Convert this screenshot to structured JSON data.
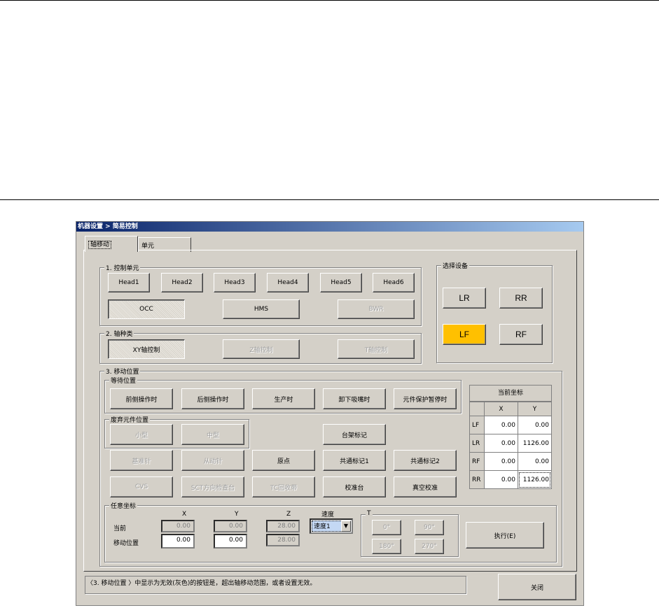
{
  "window": {
    "title": "机器设置 > 简易控制"
  },
  "tabs": [
    {
      "label": "轴移动"
    },
    {
      "label": "单元"
    }
  ],
  "control_unit": {
    "label": "1. 控制单元",
    "heads": [
      "Head1",
      "Head2",
      "Head3",
      "Head4",
      "Head5",
      "Head6"
    ],
    "occ": "OCC",
    "hms": "HMS",
    "bwr": "BWR"
  },
  "axis_type": {
    "label": "2. 轴种类",
    "xy": "XY轴控制",
    "z": "Z轴控制",
    "t": "T轴控制"
  },
  "device": {
    "label": "选择设备",
    "lr": "LR",
    "rr": "RR",
    "lf": "LF",
    "rf": "RF",
    "selected_color": "#ffc000"
  },
  "move_position": {
    "label": "3. 移动位置",
    "wait": {
      "label": "等待位置",
      "front": "前侧操作时",
      "rear": "后侧操作时",
      "production": "生产时",
      "nozzle": "卸下吸嘴时",
      "pause": "元件保护暂停时"
    },
    "discard": {
      "label": "废弃元件位置",
      "small": "小型",
      "medium": "中型"
    },
    "rack": "台架标记",
    "ref_pin": "基准针",
    "slave_pin": "从动针",
    "origin": "原点",
    "common1": "共通标记1",
    "common2": "共通标记2",
    "cvs": "CVS",
    "sct": "SCT方向检查台",
    "tc": "TC回收带",
    "calib": "校准台",
    "vacuum": "真空校准"
  },
  "current_coords": {
    "title": "当前坐标",
    "col_x": "X",
    "col_y": "Y",
    "rows": [
      {
        "label": "LF",
        "x": "0.00",
        "y": "0.00"
      },
      {
        "label": "LR",
        "x": "0.00",
        "y": "1126.00"
      },
      {
        "label": "RF",
        "x": "0.00",
        "y": "0.00"
      },
      {
        "label": "RR",
        "x": "0.00",
        "y": "1126.00"
      }
    ]
  },
  "arbitrary": {
    "label": "任意坐标",
    "col_x": "X",
    "col_y": "Y",
    "col_z": "Z",
    "speed_label": "速度",
    "current_label": "当前",
    "move_label": "移动位置",
    "current_x": "0.00",
    "current_y": "0.00",
    "current_z": "28.00",
    "move_x": "0.00",
    "move_y": "0.00",
    "move_z": "28.00",
    "speed_value": "速度1",
    "t_label": "T",
    "t0": "0°",
    "t90": "90°",
    "t180": "180°",
    "t270": "270°",
    "execute": "执行(E)"
  },
  "status_text": "〈3. 移动位置 〉中显示为无效(灰色)的按钮是，超出轴移动范围，或者设置无效。",
  "close": "关闭"
}
